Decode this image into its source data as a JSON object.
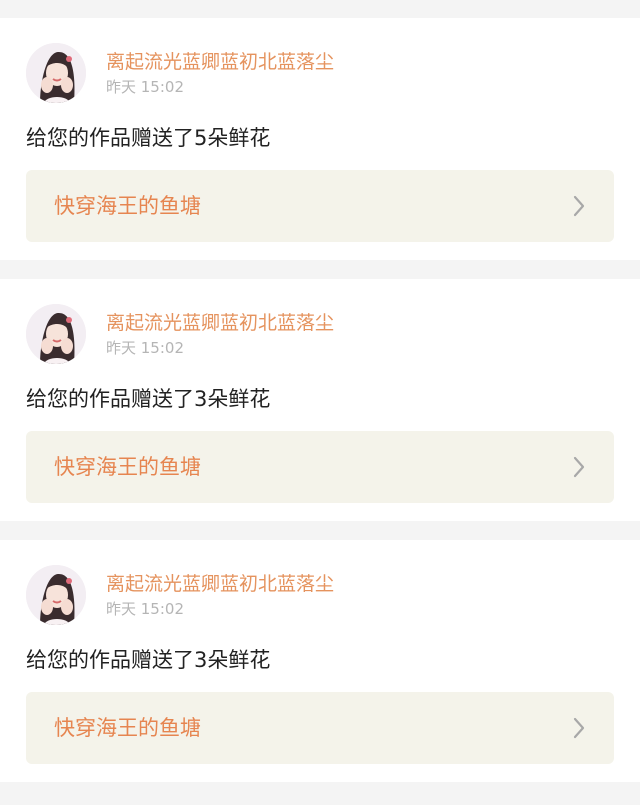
{
  "theme": {
    "username_color": "#e5935e",
    "link_title_color": "#e68550",
    "link_bg": "#f4f3ea",
    "timestamp_color": "#b5b5b5",
    "page_bg": "#f4f4f4"
  },
  "notifications": [
    {
      "avatar_icon": "user-avatar-photo",
      "username": "离起流光蓝卿蓝初北蓝落尘",
      "time": "昨天 15:02",
      "message": "给您的作品赠送了5朵鲜花",
      "work_title": "快穿海王的鱼塘",
      "chevron_icon": "chevron-right-icon"
    },
    {
      "avatar_icon": "user-avatar-photo",
      "username": "离起流光蓝卿蓝初北蓝落尘",
      "time": "昨天 15:02",
      "message": "给您的作品赠送了3朵鲜花",
      "work_title": "快穿海王的鱼塘",
      "chevron_icon": "chevron-right-icon"
    },
    {
      "avatar_icon": "user-avatar-photo",
      "username": "离起流光蓝卿蓝初北蓝落尘",
      "time": "昨天 15:02",
      "message": "给您的作品赠送了3朵鲜花",
      "work_title": "快穿海王的鱼塘",
      "chevron_icon": "chevron-right-icon"
    }
  ]
}
